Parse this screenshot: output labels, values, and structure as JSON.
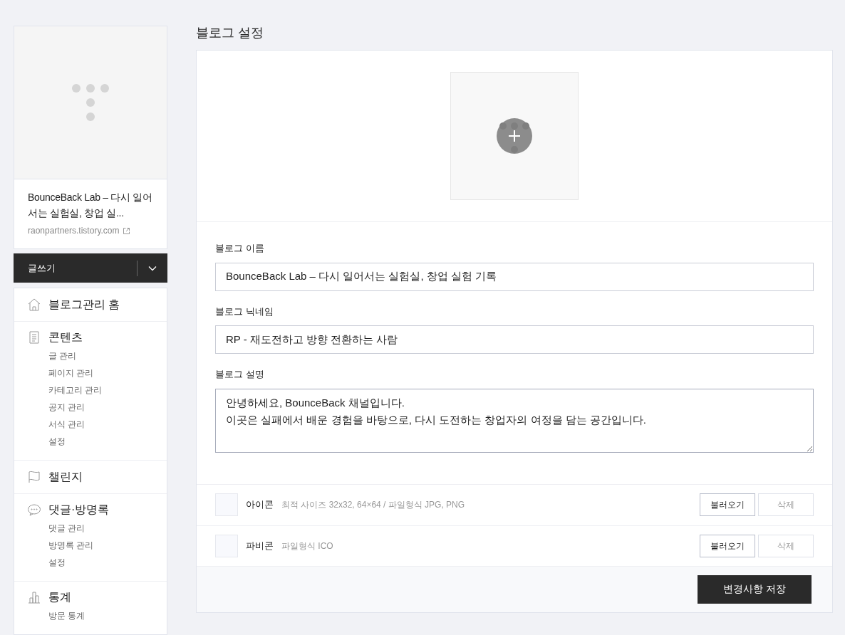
{
  "blog_card": {
    "title": "BounceBack Lab – 다시 일어서는 실험실, 창업 실...",
    "url": "raonpartners.tistory.com"
  },
  "write_button": {
    "label": "글쓰기"
  },
  "sidebar": {
    "sections": [
      {
        "kind": "home",
        "label": "블로그관리 홈"
      },
      {
        "kind": "doc",
        "label": "콘텐츠",
        "items": [
          "글 관리",
          "페이지 관리",
          "카테고리 관리",
          "공지 관리",
          "서식 관리",
          "설정"
        ]
      },
      {
        "kind": "flag",
        "label": "챌린지"
      },
      {
        "kind": "chat",
        "label": "댓글·방명록",
        "items": [
          "댓글 관리",
          "방명록 관리",
          "설정"
        ]
      },
      {
        "kind": "chart",
        "label": "통계",
        "items": [
          "방문 통계"
        ]
      }
    ]
  },
  "page_title": "블로그 설정",
  "fields": [
    {
      "kind": "input",
      "label": "블로그 이름",
      "value": "BounceBack Lab – 다시 일어서는 실험실, 창업 실험 기록"
    },
    {
      "kind": "input",
      "label": "블로그 닉네임",
      "value": "RP - 재도전하고 방향 전환하는 사람"
    },
    {
      "kind": "textarea",
      "label": "블로그 설명",
      "value": "안녕하세요, BounceBack 채널입니다.\n이곳은 실패에서 배운 경험을 바탕으로, 다시 도전하는 창업자의 여정을 담는 공간입니다.\n"
    }
  ],
  "uploads": [
    {
      "label": "아이콘",
      "hint": "최적 사이즈 32x32, 64×64 / 파일형식 JPG, PNG",
      "load": "불러오기",
      "delete": "삭제"
    },
    {
      "label": "파비콘",
      "hint": "파일형식 ICO",
      "load": "불러오기",
      "delete": "삭제"
    }
  ],
  "save_button": "변경사항 저장"
}
